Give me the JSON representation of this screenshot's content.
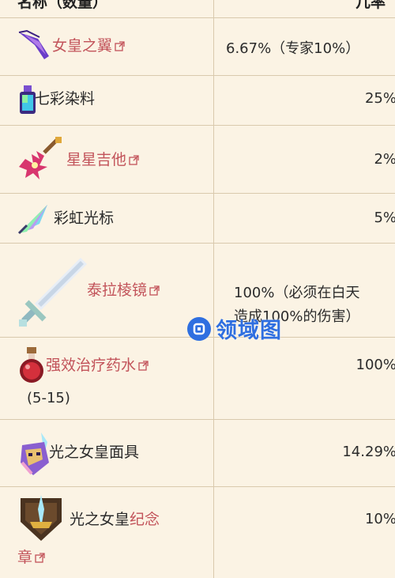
{
  "header": {
    "name_col": "名称（数量）",
    "rate_col": "几率"
  },
  "rows": [
    {
      "name": "女皇之翼",
      "rate": "6.67%（专家10%）"
    },
    {
      "name": "七彩染料",
      "rate": "25%"
    },
    {
      "name": "星星吉他",
      "rate": "2%"
    },
    {
      "name": "彩虹光标",
      "rate": "5%"
    },
    {
      "name": "泰拉棱镜",
      "rate_line1": "100%（必须在白天",
      "rate_line2": "造成100%的伤害）"
    },
    {
      "name": "强效治疗药水",
      "quantity": "(5-15)",
      "rate": "100%"
    },
    {
      "name": "光之女皇面具",
      "rate": "14.29%"
    },
    {
      "name_plain": "光之女皇",
      "name_link": "纪念",
      "name_line2": "章",
      "rate": "10%"
    }
  ],
  "watermark": {
    "text": "领域图"
  },
  "colors": {
    "link": "#c2535a",
    "background": "#fbf3e4",
    "border": "#d9c9ad",
    "watermark": "#2f6fe0"
  },
  "icons": [
    "wings-icon",
    "dye-bottle-icon",
    "guitar-icon",
    "rainbow-cursor-icon",
    "sword-icon",
    "potion-icon",
    "mask-icon",
    "badge-icon",
    "external-link-icon"
  ]
}
